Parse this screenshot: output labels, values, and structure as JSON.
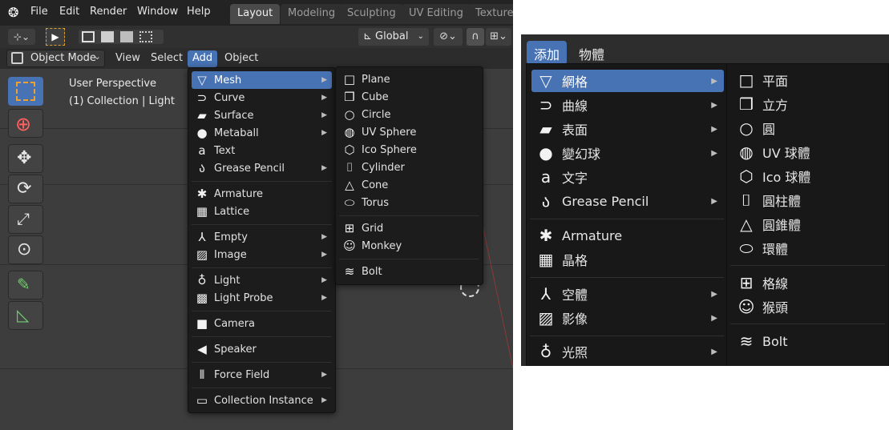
{
  "left": {
    "topbar": {
      "menus": [
        "File",
        "Edit",
        "Render",
        "Window",
        "Help"
      ],
      "workspace_tabs": [
        "Layout",
        "Modeling",
        "Sculpting",
        "UV Editing",
        "Texture"
      ],
      "active_tab": "Layout"
    },
    "toolbar": {
      "orientation": "Global"
    },
    "header": {
      "mode": "Object Mode",
      "menus": [
        "View",
        "Select",
        "Add",
        "Object"
      ],
      "active_menu": "Add"
    },
    "viewport": {
      "perspective": "User Perspective",
      "collection": "(1) Collection | Light"
    },
    "add_menu": {
      "items": [
        {
          "label": "Mesh",
          "icon": "mesh-icon",
          "submenu": true,
          "selected": true
        },
        {
          "label": "Curve",
          "icon": "curve-icon",
          "submenu": true
        },
        {
          "label": "Surface",
          "icon": "surface-icon",
          "submenu": true
        },
        {
          "label": "Metaball",
          "icon": "metaball-icon",
          "submenu": true
        },
        {
          "label": "Text",
          "icon": "text-icon",
          "submenu": false
        },
        {
          "label": "Grease Pencil",
          "icon": "grease-pencil-icon",
          "submenu": true
        },
        {
          "label": "Armature",
          "icon": "armature-icon",
          "submenu": false
        },
        {
          "label": "Lattice",
          "icon": "lattice-icon",
          "submenu": false
        },
        {
          "label": "Empty",
          "icon": "empty-icon",
          "submenu": true
        },
        {
          "label": "Image",
          "icon": "image-icon",
          "submenu": true
        },
        {
          "label": "Light",
          "icon": "light-icon",
          "submenu": true
        },
        {
          "label": "Light Probe",
          "icon": "light-probe-icon",
          "submenu": true
        },
        {
          "label": "Camera",
          "icon": "camera-icon",
          "submenu": false
        },
        {
          "label": "Speaker",
          "icon": "speaker-icon",
          "submenu": false
        },
        {
          "label": "Force Field",
          "icon": "force-field-icon",
          "submenu": true
        },
        {
          "label": "Collection Instance",
          "icon": "collection-instance-icon",
          "submenu": true
        }
      ]
    },
    "mesh_menu": {
      "items": [
        {
          "label": "Plane",
          "icon": "plane-icon"
        },
        {
          "label": "Cube",
          "icon": "cube-icon"
        },
        {
          "label": "Circle",
          "icon": "circle-icon"
        },
        {
          "label": "UV Sphere",
          "icon": "uv-sphere-icon"
        },
        {
          "label": "Ico Sphere",
          "icon": "ico-sphere-icon"
        },
        {
          "label": "Cylinder",
          "icon": "cylinder-icon"
        },
        {
          "label": "Cone",
          "icon": "cone-icon"
        },
        {
          "label": "Torus",
          "icon": "torus-icon"
        },
        {
          "label": "Grid",
          "icon": "grid-icon"
        },
        {
          "label": "Monkey",
          "icon": "monkey-icon"
        },
        {
          "label": "Bolt",
          "icon": "bolt-icon"
        }
      ]
    }
  },
  "right": {
    "header": {
      "tabs": [
        "添加",
        "物體"
      ],
      "active_tab": "添加"
    },
    "add_menu": {
      "items": [
        {
          "label": "網格",
          "icon": "mesh-icon",
          "submenu": true,
          "selected": true
        },
        {
          "label": "曲線",
          "icon": "curve-icon",
          "submenu": true
        },
        {
          "label": "表面",
          "icon": "surface-icon",
          "submenu": true
        },
        {
          "label": "變幻球",
          "icon": "metaball-icon",
          "submenu": true
        },
        {
          "label": "文字",
          "icon": "text-icon",
          "submenu": false
        },
        {
          "label": "Grease Pencil",
          "icon": "grease-pencil-icon",
          "submenu": true
        },
        {
          "label": "Armature",
          "icon": "armature-icon",
          "submenu": false
        },
        {
          "label": "晶格",
          "icon": "lattice-icon",
          "submenu": false
        },
        {
          "label": "空體",
          "icon": "empty-icon",
          "submenu": true
        },
        {
          "label": "影像",
          "icon": "image-icon",
          "submenu": true
        },
        {
          "label": "光照",
          "icon": "light-icon",
          "submenu": true
        }
      ]
    },
    "mesh_menu": {
      "items": [
        {
          "label": "平面",
          "icon": "plane-icon"
        },
        {
          "label": "立方",
          "icon": "cube-icon"
        },
        {
          "label": "圓",
          "icon": "circle-icon"
        },
        {
          "label": "UV 球體",
          "icon": "uv-sphere-icon"
        },
        {
          "label": "Ico 球體",
          "icon": "ico-sphere-icon"
        },
        {
          "label": "圓柱體",
          "icon": "cylinder-icon"
        },
        {
          "label": "圓錐體",
          "icon": "cone-icon"
        },
        {
          "label": "環體",
          "icon": "torus-icon"
        },
        {
          "label": "格線",
          "icon": "grid-icon"
        },
        {
          "label": "猴頭",
          "icon": "monkey-icon"
        },
        {
          "label": "Bolt",
          "icon": "bolt-icon"
        }
      ]
    }
  }
}
